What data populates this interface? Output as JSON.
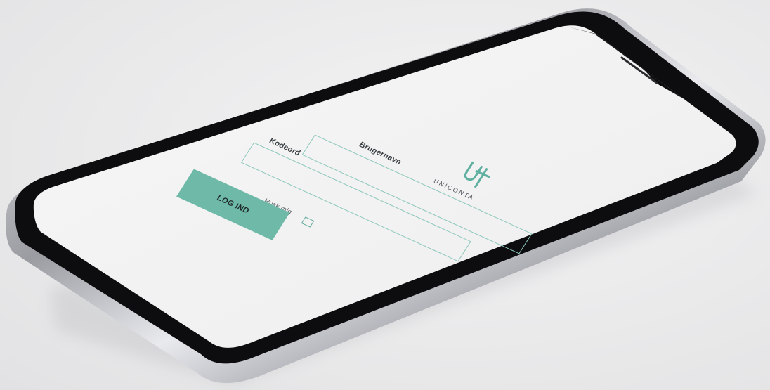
{
  "login": {
    "username_label": "Brugernavn",
    "password_label": "Kodeord",
    "username_value": "",
    "password_value": "",
    "remember_label": "Husk mig",
    "remember_checked": false,
    "login_button": "LOG IND"
  },
  "brand": {
    "name": "UNICONTA",
    "logo_icon": "uniconta-logo-icon",
    "accent_color": "#6fb9a8"
  }
}
